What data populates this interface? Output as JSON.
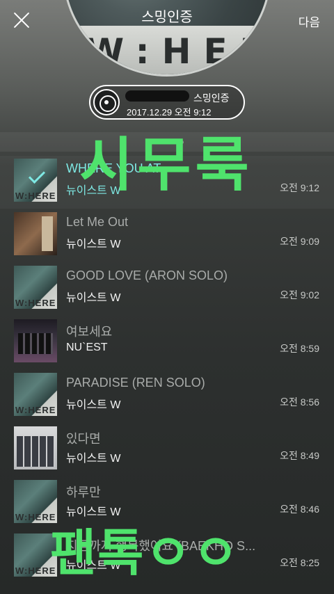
{
  "header": {
    "close_label": "",
    "next_label": "다음",
    "hero_title": "스밍인증",
    "hero_word": "W:HERE"
  },
  "badge": {
    "label": "스밍인증",
    "datetime": "2017.12.29 오전 9:12"
  },
  "tracks": [
    {
      "title": "WHERE YOU AT",
      "artist": "뉴이스트 W",
      "time": "오전 9:12",
      "selected": true,
      "art": "where-album-icon"
    },
    {
      "title": "Let Me Out",
      "artist": "뉴이스트 W",
      "time": "오전 9:09",
      "selected": false,
      "art": "let-me-out-album-icon"
    },
    {
      "title": "GOOD LOVE (ARON SOLO)",
      "artist": "뉴이스트 W",
      "time": "오전 9:02",
      "selected": false,
      "art": "where-album-icon"
    },
    {
      "title": "여보세요",
      "artist": "NU`EST",
      "time": "오전 8:59",
      "selected": false,
      "art": "hello-album-icon"
    },
    {
      "title": "PARADISE (REN SOLO)",
      "artist": "뉴이스트 W",
      "time": "오전 8:56",
      "selected": false,
      "art": "where-album-icon"
    },
    {
      "title": "있다면",
      "artist": "뉴이스트 W",
      "time": "오전 8:49",
      "selected": false,
      "art": "if-you-album-icon"
    },
    {
      "title": "하루만",
      "artist": "뉴이스트 W",
      "time": "오전 8:46",
      "selected": false,
      "art": "where-album-icon"
    },
    {
      "title": "지금까지 행복했어요 (BAEKHO S...",
      "artist": "뉴이스트 W",
      "time": "오전 8:25",
      "selected": false,
      "art": "where-album-icon"
    }
  ],
  "overlays": {
    "top_text": "시무룩",
    "bottom_text": "팬톡ㅇㅇ"
  },
  "colors": {
    "accent": "#7ee8e3",
    "marker": "#4fe36c"
  }
}
